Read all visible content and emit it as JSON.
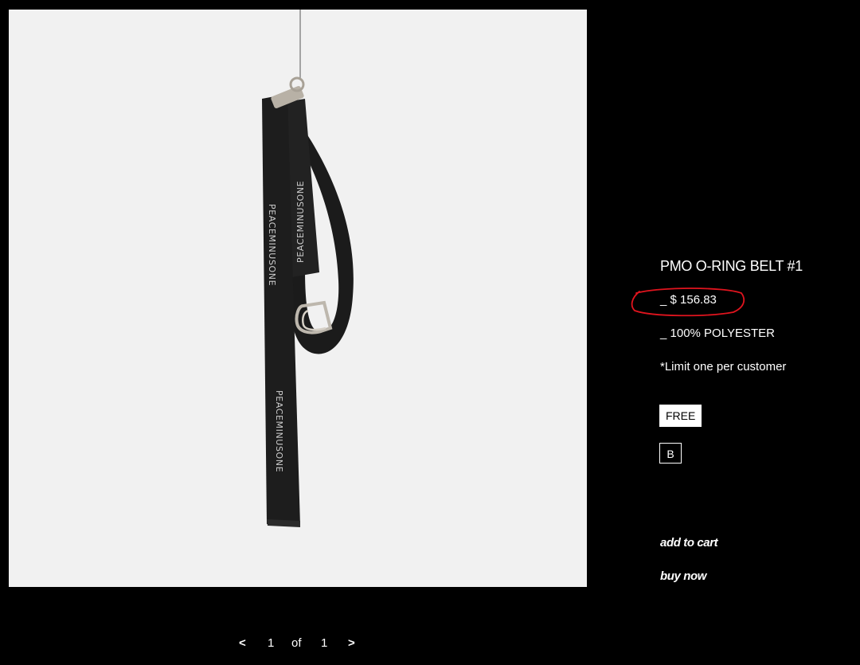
{
  "product": {
    "title": "PMO O-RING BELT #1",
    "price": "_ $ 156.83",
    "material": "_ 100% POLYESTER",
    "limit_note": "*Limit one per customer"
  },
  "options": {
    "size_label": "FREE",
    "color_label": "B"
  },
  "actions": {
    "add_to_cart": "add to cart",
    "buy_now": "buy now"
  },
  "image": {
    "belt_print": "PEACEMINUSONE"
  },
  "pagination": {
    "prev": "<",
    "current": "1",
    "of": "of",
    "total": "1",
    "next": ">"
  },
  "colors": {
    "background": "#000000",
    "photo_background": "#f1f1f1",
    "annotation": "#e0141e"
  }
}
